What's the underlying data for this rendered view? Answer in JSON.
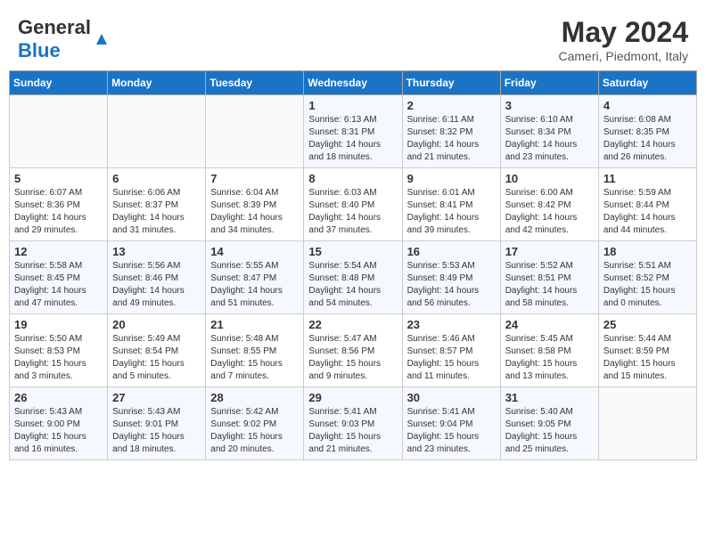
{
  "header": {
    "logo_general": "General",
    "logo_blue": "Blue",
    "month_title": "May 2024",
    "subtitle": "Cameri, Piedmont, Italy"
  },
  "days_of_week": [
    "Sunday",
    "Monday",
    "Tuesday",
    "Wednesday",
    "Thursday",
    "Friday",
    "Saturday"
  ],
  "weeks": [
    [
      {
        "day": "",
        "text": ""
      },
      {
        "day": "",
        "text": ""
      },
      {
        "day": "",
        "text": ""
      },
      {
        "day": "1",
        "text": "Sunrise: 6:13 AM\nSunset: 8:31 PM\nDaylight: 14 hours\nand 18 minutes."
      },
      {
        "day": "2",
        "text": "Sunrise: 6:11 AM\nSunset: 8:32 PM\nDaylight: 14 hours\nand 21 minutes."
      },
      {
        "day": "3",
        "text": "Sunrise: 6:10 AM\nSunset: 8:34 PM\nDaylight: 14 hours\nand 23 minutes."
      },
      {
        "day": "4",
        "text": "Sunrise: 6:08 AM\nSunset: 8:35 PM\nDaylight: 14 hours\nand 26 minutes."
      }
    ],
    [
      {
        "day": "5",
        "text": "Sunrise: 6:07 AM\nSunset: 8:36 PM\nDaylight: 14 hours\nand 29 minutes."
      },
      {
        "day": "6",
        "text": "Sunrise: 6:06 AM\nSunset: 8:37 PM\nDaylight: 14 hours\nand 31 minutes."
      },
      {
        "day": "7",
        "text": "Sunrise: 6:04 AM\nSunset: 8:39 PM\nDaylight: 14 hours\nand 34 minutes."
      },
      {
        "day": "8",
        "text": "Sunrise: 6:03 AM\nSunset: 8:40 PM\nDaylight: 14 hours\nand 37 minutes."
      },
      {
        "day": "9",
        "text": "Sunrise: 6:01 AM\nSunset: 8:41 PM\nDaylight: 14 hours\nand 39 minutes."
      },
      {
        "day": "10",
        "text": "Sunrise: 6:00 AM\nSunset: 8:42 PM\nDaylight: 14 hours\nand 42 minutes."
      },
      {
        "day": "11",
        "text": "Sunrise: 5:59 AM\nSunset: 8:44 PM\nDaylight: 14 hours\nand 44 minutes."
      }
    ],
    [
      {
        "day": "12",
        "text": "Sunrise: 5:58 AM\nSunset: 8:45 PM\nDaylight: 14 hours\nand 47 minutes."
      },
      {
        "day": "13",
        "text": "Sunrise: 5:56 AM\nSunset: 8:46 PM\nDaylight: 14 hours\nand 49 minutes."
      },
      {
        "day": "14",
        "text": "Sunrise: 5:55 AM\nSunset: 8:47 PM\nDaylight: 14 hours\nand 51 minutes."
      },
      {
        "day": "15",
        "text": "Sunrise: 5:54 AM\nSunset: 8:48 PM\nDaylight: 14 hours\nand 54 minutes."
      },
      {
        "day": "16",
        "text": "Sunrise: 5:53 AM\nSunset: 8:49 PM\nDaylight: 14 hours\nand 56 minutes."
      },
      {
        "day": "17",
        "text": "Sunrise: 5:52 AM\nSunset: 8:51 PM\nDaylight: 14 hours\nand 58 minutes."
      },
      {
        "day": "18",
        "text": "Sunrise: 5:51 AM\nSunset: 8:52 PM\nDaylight: 15 hours\nand 0 minutes."
      }
    ],
    [
      {
        "day": "19",
        "text": "Sunrise: 5:50 AM\nSunset: 8:53 PM\nDaylight: 15 hours\nand 3 minutes."
      },
      {
        "day": "20",
        "text": "Sunrise: 5:49 AM\nSunset: 8:54 PM\nDaylight: 15 hours\nand 5 minutes."
      },
      {
        "day": "21",
        "text": "Sunrise: 5:48 AM\nSunset: 8:55 PM\nDaylight: 15 hours\nand 7 minutes."
      },
      {
        "day": "22",
        "text": "Sunrise: 5:47 AM\nSunset: 8:56 PM\nDaylight: 15 hours\nand 9 minutes."
      },
      {
        "day": "23",
        "text": "Sunrise: 5:46 AM\nSunset: 8:57 PM\nDaylight: 15 hours\nand 11 minutes."
      },
      {
        "day": "24",
        "text": "Sunrise: 5:45 AM\nSunset: 8:58 PM\nDaylight: 15 hours\nand 13 minutes."
      },
      {
        "day": "25",
        "text": "Sunrise: 5:44 AM\nSunset: 8:59 PM\nDaylight: 15 hours\nand 15 minutes."
      }
    ],
    [
      {
        "day": "26",
        "text": "Sunrise: 5:43 AM\nSunset: 9:00 PM\nDaylight: 15 hours\nand 16 minutes."
      },
      {
        "day": "27",
        "text": "Sunrise: 5:43 AM\nSunset: 9:01 PM\nDaylight: 15 hours\nand 18 minutes."
      },
      {
        "day": "28",
        "text": "Sunrise: 5:42 AM\nSunset: 9:02 PM\nDaylight: 15 hours\nand 20 minutes."
      },
      {
        "day": "29",
        "text": "Sunrise: 5:41 AM\nSunset: 9:03 PM\nDaylight: 15 hours\nand 21 minutes."
      },
      {
        "day": "30",
        "text": "Sunrise: 5:41 AM\nSunset: 9:04 PM\nDaylight: 15 hours\nand 23 minutes."
      },
      {
        "day": "31",
        "text": "Sunrise: 5:40 AM\nSunset: 9:05 PM\nDaylight: 15 hours\nand 25 minutes."
      },
      {
        "day": "",
        "text": ""
      }
    ]
  ]
}
